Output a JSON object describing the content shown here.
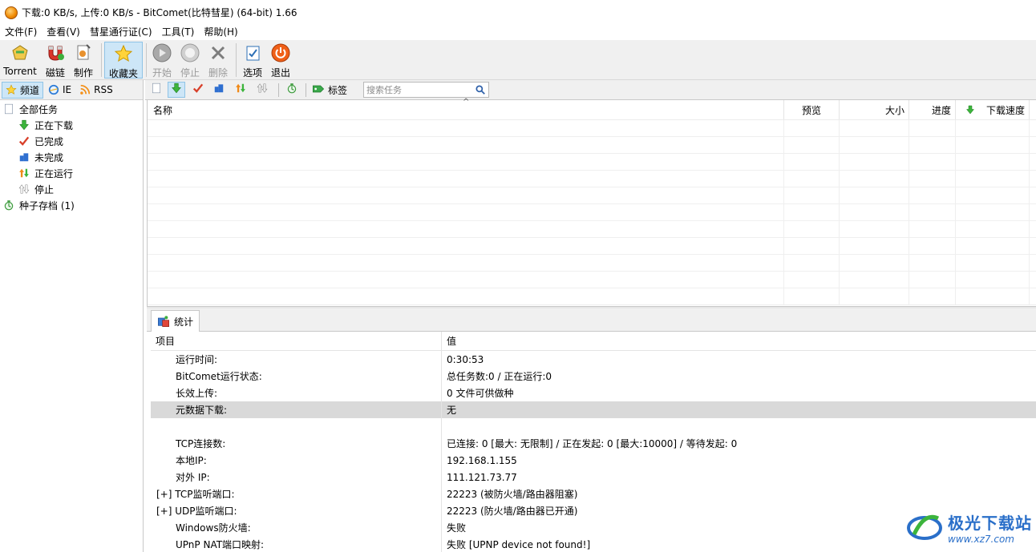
{
  "window": {
    "title": "下载:0 KB/s, 上传:0 KB/s - BitComet(比特彗星) (64-bit) 1.66"
  },
  "menu": [
    "文件(F)",
    "查看(V)",
    "彗星通行证(C)",
    "工具(T)",
    "帮助(H)"
  ],
  "toolbar": {
    "torrent": "Torrent",
    "magnet": "磁链",
    "make": "制作",
    "favorites": "收藏夹",
    "start": "开始",
    "stop": "停止",
    "delete": "删除",
    "options": "选项",
    "exit": "退出"
  },
  "sidebar": {
    "tabs": [
      {
        "label": "频道",
        "icon": "star-icon",
        "active": true
      },
      {
        "label": "IE",
        "icon": "ie-icon",
        "active": false
      },
      {
        "label": "RSS",
        "icon": "rss-icon",
        "active": false
      }
    ],
    "tree": [
      {
        "label": "全部任务",
        "icon": "all-tasks-icon",
        "level": 0
      },
      {
        "label": "正在下载",
        "icon": "download-arrow-icon",
        "level": 1
      },
      {
        "label": "已完成",
        "icon": "checkmark-icon",
        "level": 1
      },
      {
        "label": "未完成",
        "icon": "incomplete-icon",
        "level": 1
      },
      {
        "label": "正在运行",
        "icon": "running-icon",
        "level": 1
      },
      {
        "label": "停止",
        "icon": "stopped-icon",
        "level": 1
      },
      {
        "label": "种子存档 (1)",
        "icon": "torrent-archive-icon",
        "level": 0
      }
    ]
  },
  "task_toolbar": {
    "tag_label": "标签",
    "search_placeholder": "搜索任务"
  },
  "task_list": {
    "columns": [
      "名称",
      "预览",
      "大小",
      "进度",
      "下载速度"
    ],
    "rows": []
  },
  "bottom_tab": {
    "label": "统计"
  },
  "stats": {
    "header_key": "项目",
    "header_value": "值",
    "rows": [
      {
        "key": "运行时间:",
        "value": "0:30:53",
        "style": "indent"
      },
      {
        "key": "BitComet运行状态:",
        "value": "总任务数:0 / 正在运行:0",
        "style": "indent"
      },
      {
        "key": "长效上传:",
        "value": "0 文件可供做种",
        "style": "indent"
      },
      {
        "key": "元数据下载:",
        "value": "无",
        "style": "indent",
        "selected": true
      },
      {
        "key": "",
        "value": "",
        "style": "indent"
      },
      {
        "key": "TCP连接数:",
        "value": "已连接: 0 [最大: 无限制] / 正在发起: 0 [最大:10000] / 等待发起: 0",
        "style": "indent"
      },
      {
        "key": "本地IP:",
        "value": "192.168.1.155",
        "style": "indent"
      },
      {
        "key": "对外 IP:",
        "value": "111.121.73.77",
        "style": "indent"
      },
      {
        "key": "[+] TCP监听端口:",
        "value": "22223 (被防火墙/路由器阻塞)",
        "style": "expand"
      },
      {
        "key": "[+] UDP监听端口:",
        "value": "22223 (防火墙/路由器已开通)",
        "style": "expand"
      },
      {
        "key": "Windows防火墙:",
        "value": "失败",
        "style": "indent"
      },
      {
        "key": "UPnP NAT端口映射:",
        "value": "失败 [UPNP device not found!]",
        "style": "indent"
      }
    ]
  },
  "watermark": {
    "title": "极光下载站",
    "url": "www.xz7.com"
  }
}
